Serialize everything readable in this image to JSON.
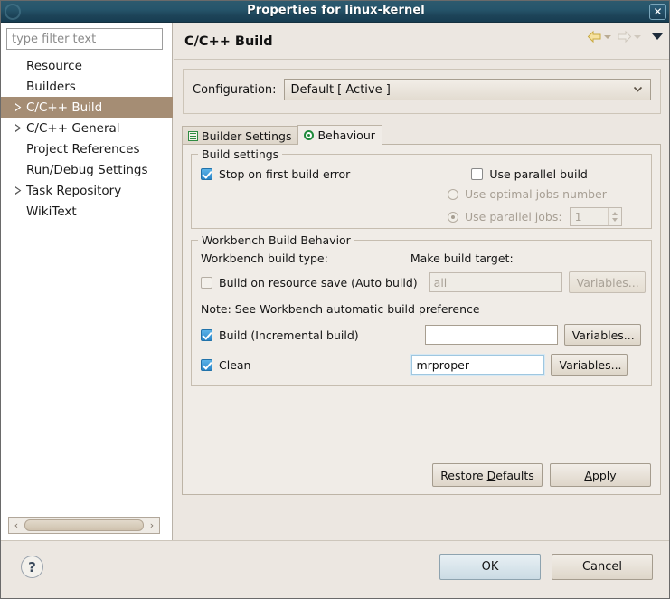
{
  "window": {
    "title": "Properties for linux-kernel",
    "close_label": "✕",
    "icon": "window-icon"
  },
  "sidebar": {
    "filter": {
      "value": "",
      "placeholder": "type filter text"
    },
    "items": [
      {
        "label": "Resource",
        "expandable": false,
        "selected": false
      },
      {
        "label": "Builders",
        "expandable": false,
        "selected": false
      },
      {
        "label": "C/C++ Build",
        "expandable": true,
        "selected": true
      },
      {
        "label": "C/C++ General",
        "expandable": true,
        "selected": false
      },
      {
        "label": "Project References",
        "expandable": false,
        "selected": false
      },
      {
        "label": "Run/Debug Settings",
        "expandable": false,
        "selected": false
      },
      {
        "label": "Task Repository",
        "expandable": true,
        "selected": false
      },
      {
        "label": "WikiText",
        "expandable": false,
        "selected": false
      }
    ],
    "scroll_left": "‹",
    "scroll_right": "›"
  },
  "page": {
    "title": "C/C++ Build",
    "nav": {
      "back_icon": "back-arrow-icon",
      "forward_icon": "forward-arrow-icon",
      "menu_icon": "view-menu-icon"
    }
  },
  "configuration": {
    "label": "Configuration:",
    "value": "Default  [ Active ]"
  },
  "tabs": [
    {
      "label": "Builder Settings",
      "icon": "list-icon",
      "active": false
    },
    {
      "label": "Behaviour",
      "icon": "radio-icon",
      "active": true
    }
  ],
  "build_settings": {
    "legend": "Build settings",
    "stop_on_first_error": {
      "label": "Stop on first build error",
      "checked": true,
      "enabled": true
    },
    "use_parallel_build": {
      "label": "Use parallel build",
      "checked": false,
      "enabled": true
    },
    "use_optimal_jobs": {
      "label": "Use optimal jobs number",
      "selected": false,
      "enabled": false
    },
    "use_parallel_jobs": {
      "label": "Use parallel jobs:",
      "selected": true,
      "enabled": false
    },
    "parallel_jobs_value": "1"
  },
  "workbench": {
    "legend": "Workbench Build Behavior",
    "build_type_label": "Workbench build type:",
    "make_target_label": "Make build target:",
    "note": "Note: See Workbench automatic build preference",
    "rows": [
      {
        "label": "Build on resource save (Auto build)",
        "checked": false,
        "enabled": false,
        "target_value": "all",
        "target_enabled": false,
        "button": "Variables...",
        "button_enabled": false
      },
      {
        "label": "Build (Incremental build)",
        "checked": true,
        "enabled": true,
        "target_value": "",
        "target_enabled": true,
        "button": "Variables...",
        "button_enabled": true
      },
      {
        "label": "Clean",
        "checked": true,
        "enabled": true,
        "target_value": "mrproper",
        "target_enabled": true,
        "focused": true,
        "button": "Variables...",
        "button_enabled": true
      }
    ]
  },
  "actions": {
    "restore_defaults": "Restore Defaults",
    "restore_defaults_mnemonic": "D",
    "apply": "Apply",
    "apply_mnemonic": "A"
  },
  "dialog": {
    "help": "?",
    "ok": "OK",
    "cancel": "Cancel"
  }
}
